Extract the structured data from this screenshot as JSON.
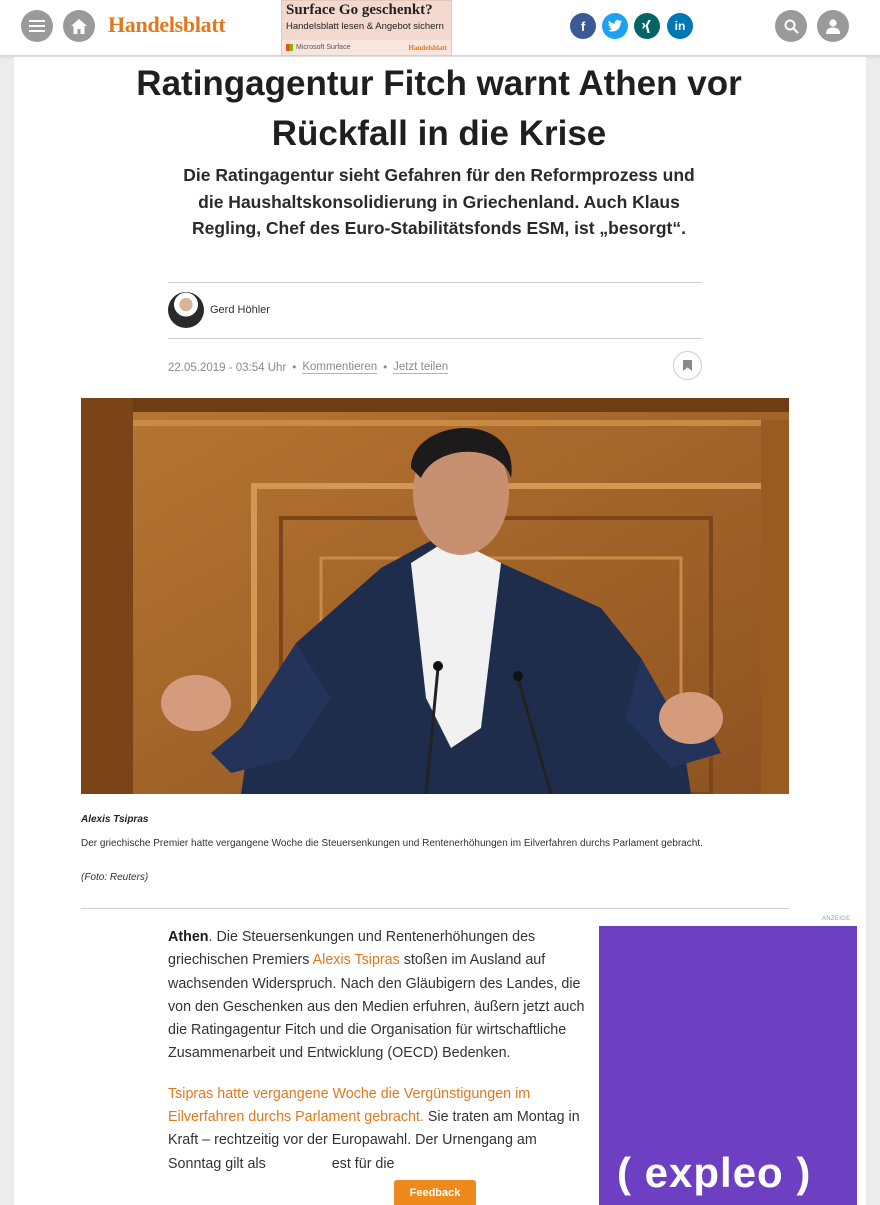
{
  "header": {
    "logo": "Handelsblatt",
    "menu_icon": "menu-icon",
    "home_icon": "home-icon",
    "search_icon": "search-icon",
    "user_icon": "user-icon",
    "ad": {
      "title": "Surface Go geschenkt?",
      "subtitle": "Handelsblatt lesen & Angebot sichern",
      "sponsor": "Microsoft Surface",
      "brand": "Handelsblatt"
    },
    "social": [
      {
        "icon": "facebook-icon",
        "glyph": "f",
        "color": "#3b5998"
      },
      {
        "icon": "twitter-icon",
        "glyph": "t",
        "color": "#1da1f2"
      },
      {
        "icon": "xing-icon",
        "glyph": "x",
        "color": "#026466"
      },
      {
        "icon": "linkedin-icon",
        "glyph": "in",
        "color": "#0077b5"
      }
    ]
  },
  "article": {
    "headline": "Ratingagentur Fitch warnt Athen vor Rückfall in die Krise",
    "lead": "Die Ratingagentur sieht Gefahren für den Reformprozess und die Haushaltskonsolidierung in Griechenland. Auch Klaus Regling, Chef des Euro-Stabilitätsfonds ESM, ist „besorgt“.",
    "author": "Gerd Höhler",
    "date": "22.05.2019 - 03:54 Uhr",
    "sep": "•",
    "comment_link": "Kommentieren",
    "share_link": "Jetzt teilen",
    "bookmark_icon": "bookmark-icon",
    "image": {
      "caption_name": "Alexis Tsipras",
      "caption_text": "Der griechische Premier hatte vergangene Woche die Steuersenkungen und Rentenerhöhungen im Eilverfahren durchs Parlament gebracht.",
      "credit": "(Foto: Reuters)"
    },
    "p1": {
      "dateline": "Athen",
      "t1": ". Die Steuersenkungen und Rentenerhöhungen des griechischen Premiers ",
      "link": "Alexis Tsipras",
      "t2": " stoßen im Ausland auf wachsenden Widerspruch. Nach den Gläubigern des Landes, die von den Geschenken aus den Medien erfuhren, äußern jetzt auch die Ratingagentur Fitch und die Organisation für wirtschaftliche Zusammenarbeit und Entwicklung (OECD) Bedenken."
    },
    "p2": {
      "link": "Tsipras hatte vergangene Woche die Vergünstigungen im Eilverfahren durchs Parlament gebracht.",
      "t1": " Sie traten am Montag in Kraft – rechtzeitig vor der Europawahl. Der Urnengang am Sonntag gilt als ",
      "t2": "est für die"
    }
  },
  "sidebar_ad": {
    "label": "ANZEIGE",
    "brand": "( expleo )",
    "color": "#6d3fc2"
  },
  "feedback_label": "Feedback"
}
